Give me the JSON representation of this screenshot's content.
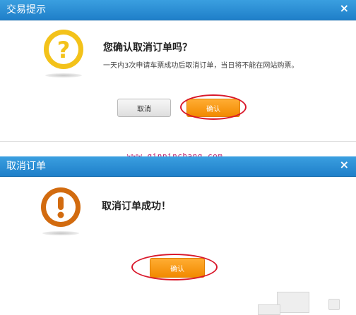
{
  "dialog1": {
    "title": "交易提示",
    "close": "×",
    "icon": "question-circle-icon",
    "message_title": "您确认取消订单吗？",
    "message_detail": "一天内3次申请车票成功后取消订单，当日将不能在网站购票。",
    "cancel_label": "取消",
    "confirm_label": "确认"
  },
  "watermark": "www.qinpinchang.com",
  "dialog2": {
    "title": "取消订单",
    "close": "×",
    "icon": "exclamation-circle-icon",
    "message_title": "取消订单成功！",
    "confirm_label": "确认"
  },
  "colors": {
    "titlebar": "#2a8fd6",
    "question_icon": "#f3c21a",
    "alert_icon": "#d26b0f",
    "orange_button": "#f5951a",
    "highlight_ring": "#d9182b",
    "watermark": "#c01d6a"
  }
}
